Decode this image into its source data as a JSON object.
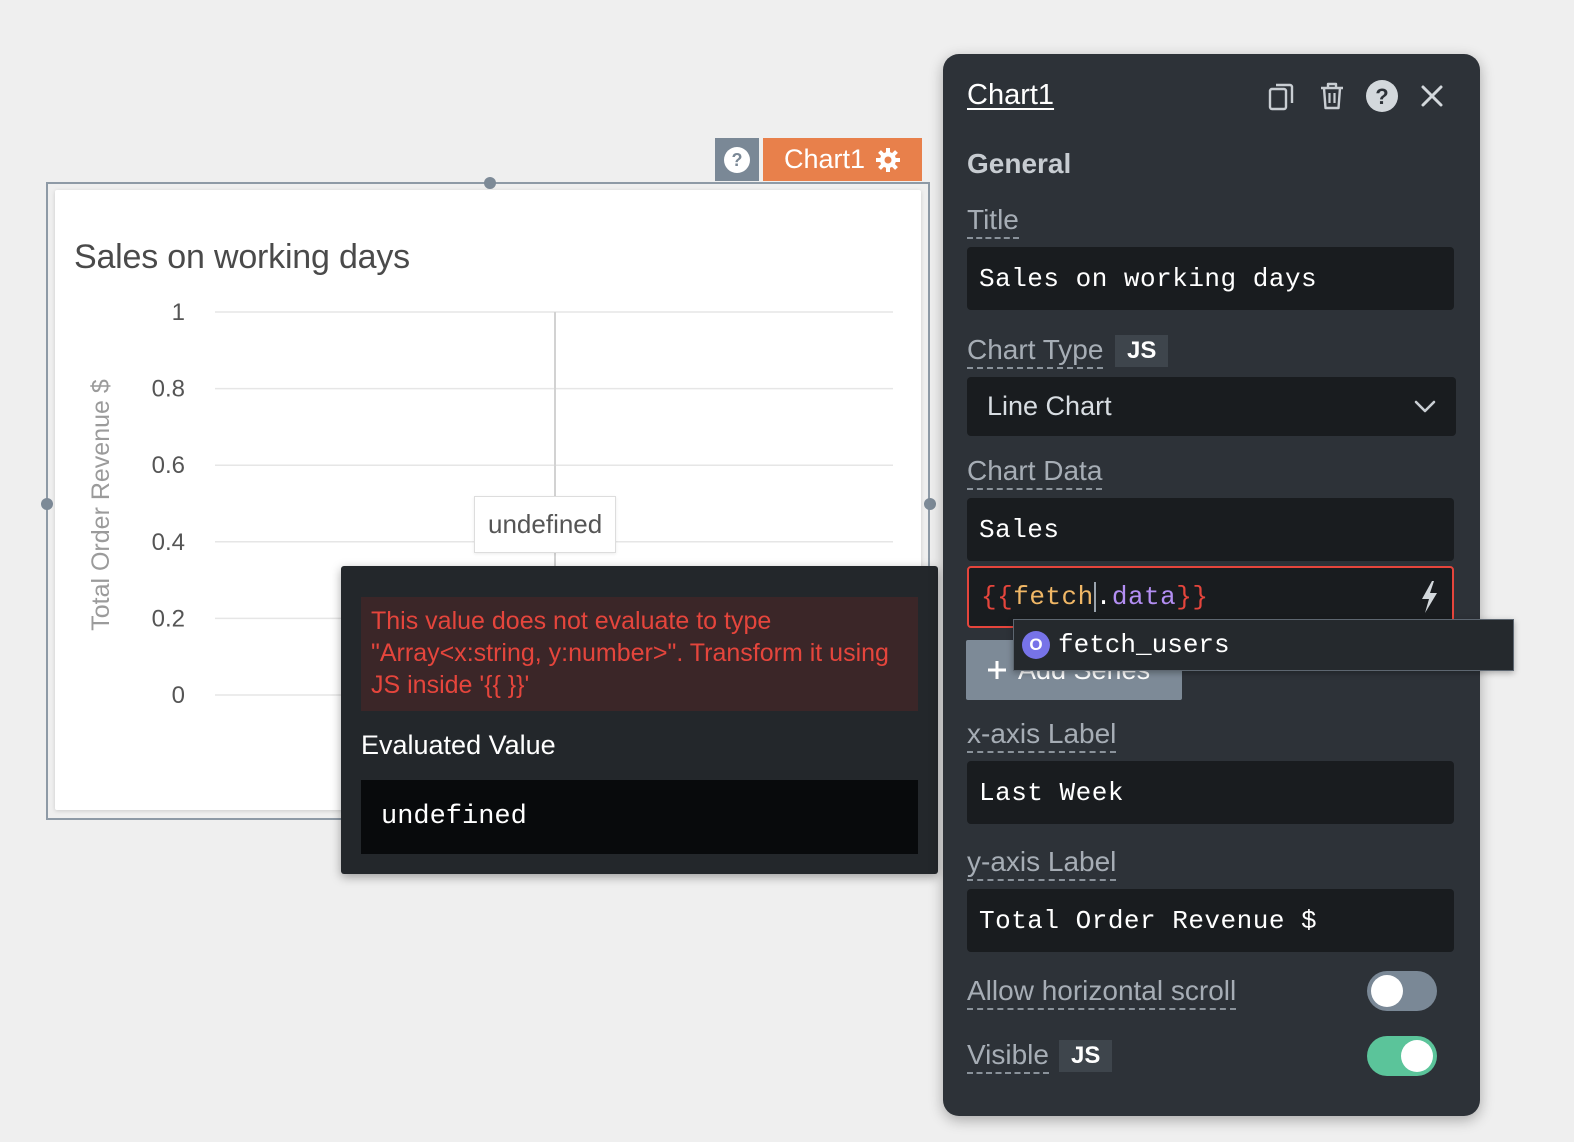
{
  "widget": {
    "name": "Chart1",
    "help_glyph": "?"
  },
  "chart": {
    "title": "Sales on working days",
    "tooltip": "undefined"
  },
  "chart_data": {
    "type": "line",
    "title": "Sales on working days",
    "xlabel": "",
    "ylabel": "Total Order Revenue $",
    "ylim": [
      0,
      1
    ],
    "yticks": [
      "1",
      "0.8",
      "0.6",
      "0.4",
      "0.2",
      "0"
    ],
    "series": [],
    "grid": true
  },
  "error_popover": {
    "message": "This value does not evaluate to type \"Array<x:string, y:number>\". Transform it using JS inside '{{ }}'",
    "evaluated_label": "Evaluated Value",
    "evaluated_value": "undefined"
  },
  "pane": {
    "title": "Chart1",
    "section": "General",
    "title_label": "Title",
    "title_value": "Sales on working days",
    "chart_type_label": "Chart Type",
    "js_badge": "JS",
    "chart_type_value": "Line Chart",
    "chart_data_label": "Chart Data",
    "series_name": "Sales",
    "series_data": {
      "open": "{{",
      "fetch": "fetch",
      "dot": ".",
      "data": "data",
      "close": "}}"
    },
    "add_series_label": "Add Series",
    "xaxis_label": "x-axis Label",
    "xaxis_value": "Last Week",
    "yaxis_label": "y-axis Label",
    "yaxis_value": "Total Order Revenue $",
    "hscroll_label": "Allow horizontal scroll",
    "hscroll_on": false,
    "visible_label": "Visible",
    "visible_on": true
  },
  "autocomplete": {
    "icon_letter": "O",
    "item": "fetch_users"
  },
  "colors": {
    "accent_orange": "#e8804b",
    "error_red": "#e5453c",
    "toggle_on": "#5bc49a",
    "toggle_off": "#7a8896",
    "pane_bg": "#2d3238"
  }
}
